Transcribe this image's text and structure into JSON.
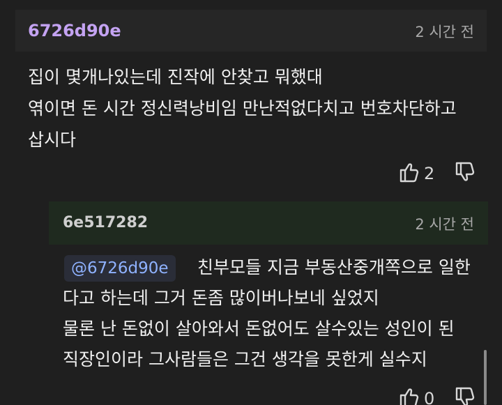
{
  "comment": {
    "author": "6726d90e",
    "time": "2 시간 전",
    "lines": [
      "집이 몇개나있는데 진작에 안찾고 뭐했대",
      "엮이면 돈 시간 정신력낭비임 만난적없다치고 번호차단하고",
      "삽시다"
    ],
    "like_count": "2",
    "like_icon": "thumbs-up-icon",
    "dislike_icon": "thumbs-down-icon"
  },
  "reply": {
    "author": "6e517282",
    "time": "2 시간 전",
    "mention": "@6726d90e",
    "lines": [
      "친부모들 지금 부동산중개쪽으로 일한",
      "다고 하는데 그거 돈좀 많이버나보네 싶었지",
      "물론 난 돈없이 살아와서 돈없어도 살수있는 성인이 된",
      "직장인이라 그사람들은 그건 생각을 못한게 실수지"
    ],
    "like_count": "0"
  },
  "colors": {
    "background": "#1f1f1f",
    "author_accent": "#c4a3f2",
    "mention_text": "#8fb2ff",
    "reply_header": "#1f2a1f"
  }
}
